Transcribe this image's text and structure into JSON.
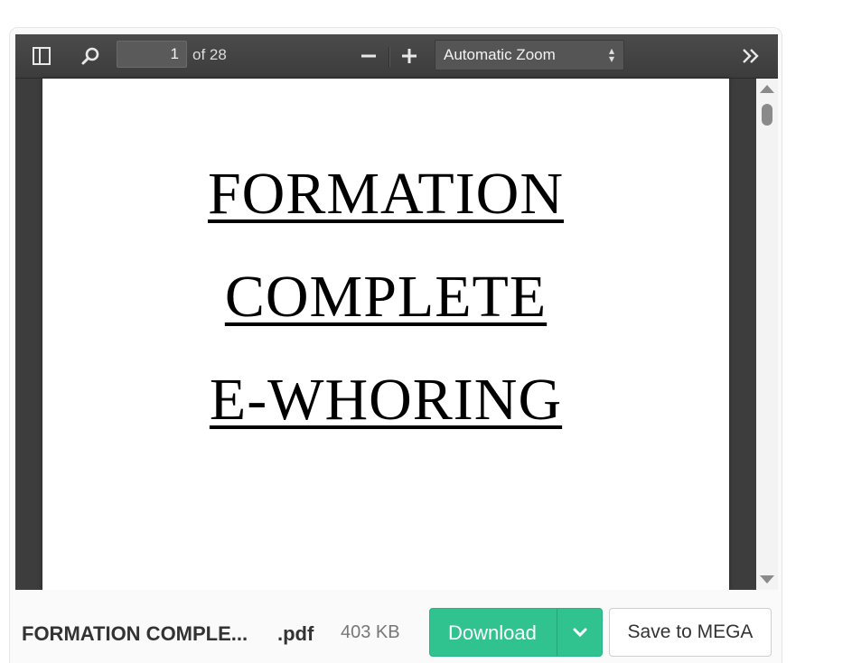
{
  "toolbar": {
    "page_current": "1",
    "page_total_label": "of 28",
    "zoom_selected": "Automatic Zoom"
  },
  "document": {
    "lines": [
      "FORMATION",
      "COMPLETE",
      "E-WHORING"
    ]
  },
  "file": {
    "name": "FORMATION COMPLE...",
    "extension": ".pdf",
    "size": "403 KB"
  },
  "actions": {
    "download_label": "Download",
    "save_label": "Save to MEGA"
  },
  "colors": {
    "download_accent": "#31c38f",
    "toolbar": "#444444"
  },
  "icons": [
    "sidebar-toggle-icon",
    "search-icon",
    "zoom-out-icon",
    "zoom-in-icon",
    "select-arrows-icon",
    "double-chevron-right-icon",
    "chevron-down-icon"
  ]
}
